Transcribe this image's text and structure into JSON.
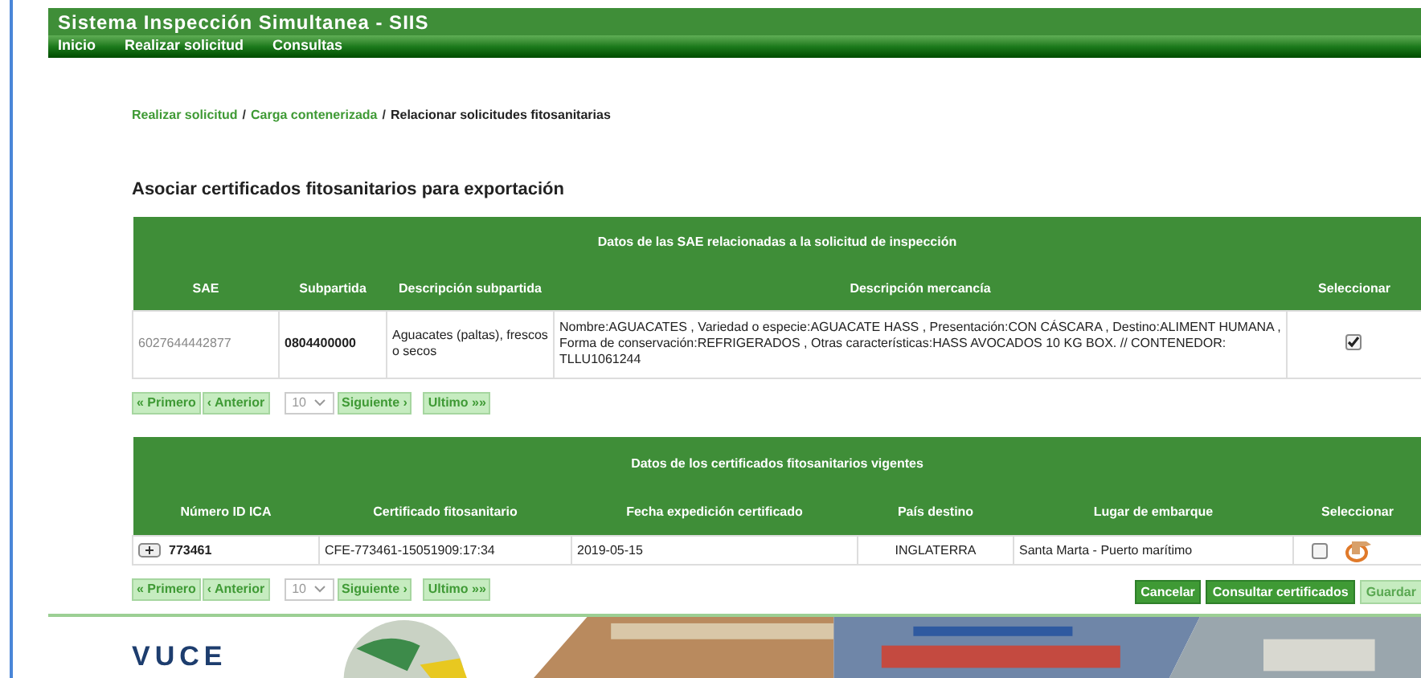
{
  "app": {
    "title": "Sistema Inspección Simultanea - SIIS"
  },
  "nav": [
    {
      "label": "Inicio"
    },
    {
      "label": "Realizar solicitud"
    },
    {
      "label": "Consultas"
    }
  ],
  "breadcrumb": {
    "separator": "/",
    "items": [
      {
        "label": "Realizar solicitud",
        "link": true
      },
      {
        "label": "Carga contenerizada",
        "link": true
      },
      {
        "label": "Relacionar solicitudes fitosanitarias",
        "link": false
      }
    ]
  },
  "page_title": "Asociar certificados fitosanitarios para exportación",
  "sae_table": {
    "caption": "Datos de las SAE relacionadas a la solicitud de inspección",
    "columns": [
      "SAE",
      "Subpartida",
      "Descripción subpartida",
      "Descripción mercancía",
      "Seleccionar"
    ],
    "rows": [
      {
        "sae": "6027644442877",
        "subpartida": "0804400000",
        "descripcion": "Aguacates (paltas), frescos o secos",
        "mercancia": "Nombre:AGUACATES , Variedad o especie:AGUACATE HASS , Presentación:CON CÁSCARA , Destino:ALIMENT HUMANA , Forma de conservación:REFRIGERADOS , Otras características:HASS AVOCADOS 10 KG BOX. // CONTENEDOR: TLLU1061244",
        "checked": true
      }
    ]
  },
  "sae_pager": {
    "first": "« Primero",
    "prev": "‹ Anterior",
    "page_size": "10",
    "next": "Siguiente ›",
    "last": "Ultimo »»"
  },
  "cert_table": {
    "caption": "Datos de los certificados fitosanitarios vigentes",
    "columns": [
      "Número ID ICA",
      "Certificado fitosanitario",
      "Fecha expedición certificado",
      "País destino",
      "Lugar de embarque",
      "Seleccionar"
    ],
    "rows": [
      {
        "id": "773461",
        "certificado": "CFE-773461-15051909:17:34",
        "fecha": "2019-05-15",
        "pais": "INGLATERRA",
        "lugar": "Santa Marta - Puerto marítimo",
        "checked": false
      }
    ]
  },
  "cert_pager": {
    "first": "« Primero",
    "prev": "‹ Anterior",
    "page_size": "10",
    "next": "Siguiente ›",
    "last": "Ultimo »»"
  },
  "actions": [
    {
      "label": "Cancelar",
      "disabled": false
    },
    {
      "label": "Consultar certificados",
      "disabled": false
    },
    {
      "label": "Guardar",
      "disabled": true
    }
  ],
  "footer": {
    "logo": "VUCE"
  }
}
